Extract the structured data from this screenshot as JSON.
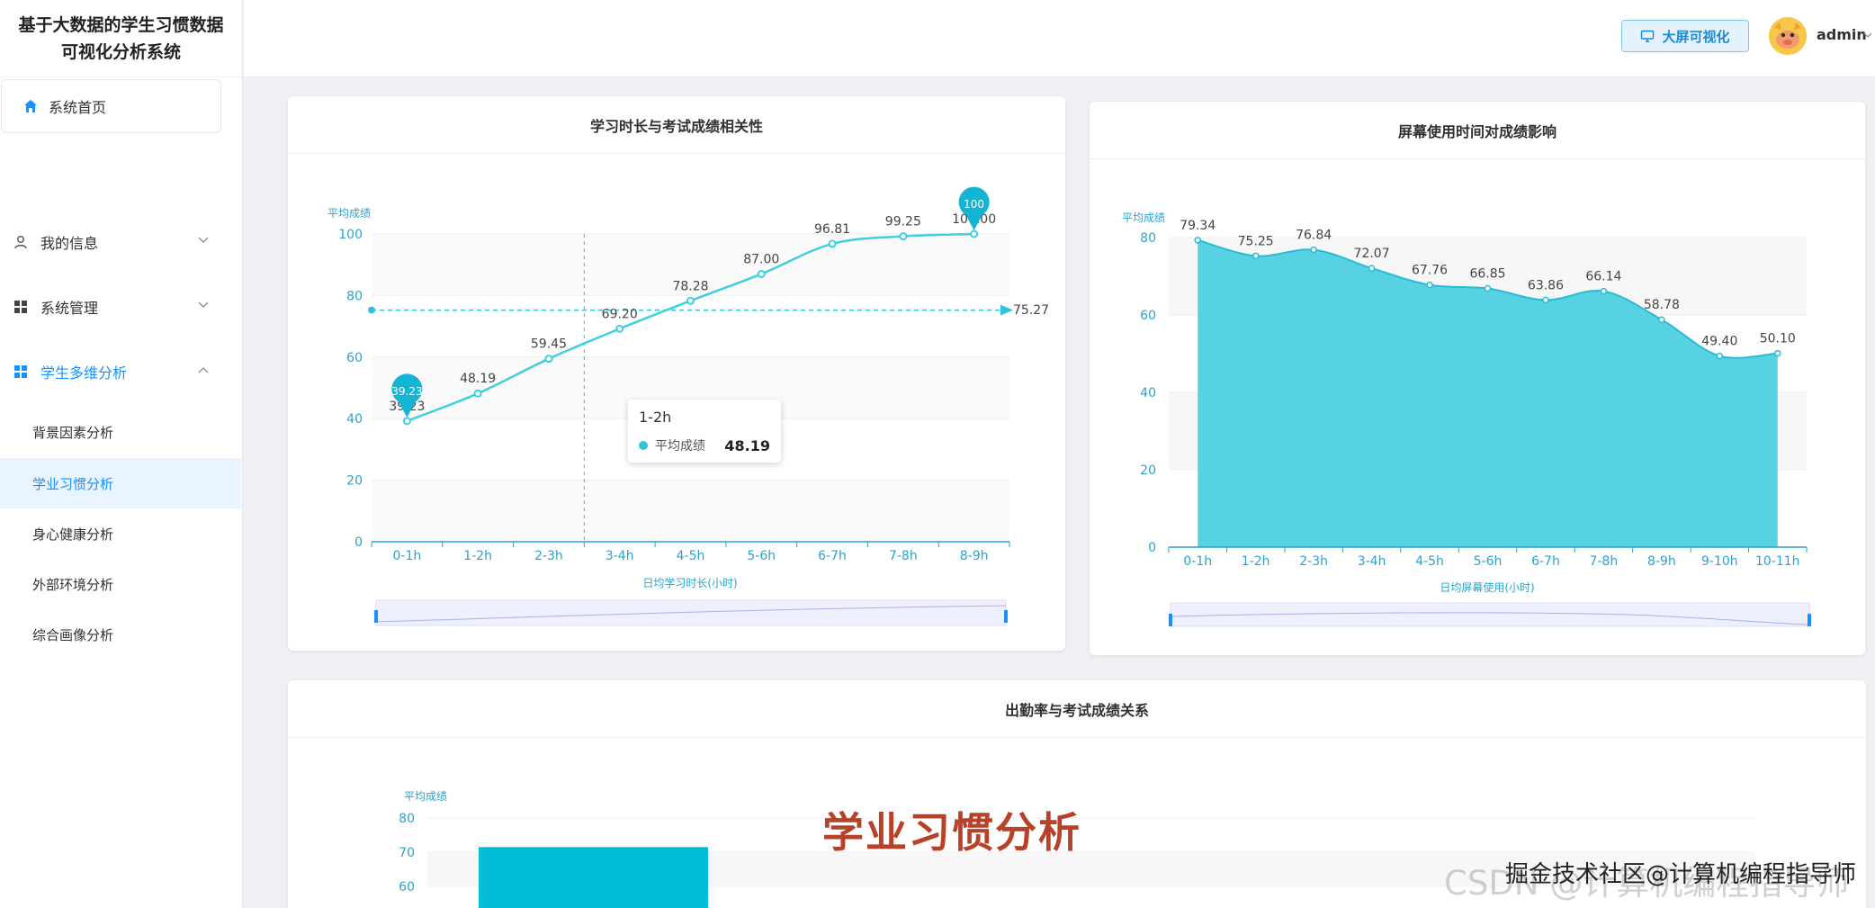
{
  "app": {
    "title_line1": "基于大数据的学生习惯数据",
    "title_line2": "可视化分析系统"
  },
  "header": {
    "big_screen_button": "大屏可视化",
    "username": "admin"
  },
  "sidebar": {
    "home": "系统首页",
    "items": [
      {
        "label": "我的信息"
      },
      {
        "label": "系统管理"
      },
      {
        "label": "学生多维分析"
      }
    ],
    "subitems": [
      {
        "label": "背景因素分析"
      },
      {
        "label": "学业习惯分析"
      },
      {
        "label": "身心健康分析"
      },
      {
        "label": "外部环境分析"
      },
      {
        "label": "综合画像分析"
      }
    ]
  },
  "chart_data": [
    {
      "type": "line",
      "title": "学习时长与考试成绩相关性",
      "xlabel": "日均学习时长(小时)",
      "ylabel": "平均成绩",
      "categories": [
        "0-1h",
        "1-2h",
        "2-3h",
        "3-4h",
        "4-5h",
        "5-6h",
        "6-7h",
        "7-8h",
        "8-9h"
      ],
      "values": [
        39.23,
        48.19,
        59.45,
        69.2,
        78.28,
        87.0,
        96.81,
        99.25,
        100.0
      ],
      "ylim": [
        0,
        100
      ],
      "yticks": [
        0,
        20,
        40,
        60,
        80,
        100
      ],
      "average_line": 75.27,
      "markpoint_min": "39.23",
      "markpoint_max": "100",
      "tooltip": {
        "category": "1-2h",
        "series": "平均成绩",
        "value": "48.19"
      }
    },
    {
      "type": "area",
      "title": "屏幕使用时间对成绩影响",
      "xlabel": "日均屏幕使用(小时)",
      "ylabel": "平均成绩",
      "categories": [
        "0-1h",
        "1-2h",
        "2-3h",
        "3-4h",
        "4-5h",
        "5-6h",
        "6-7h",
        "7-8h",
        "8-9h",
        "9-10h",
        "10-11h"
      ],
      "values": [
        79.34,
        75.25,
        76.84,
        72.07,
        67.76,
        66.85,
        63.86,
        66.14,
        58.78,
        49.4,
        50.1
      ],
      "ylim": [
        0,
        80
      ],
      "yticks": [
        0,
        20,
        40,
        60,
        80
      ]
    },
    {
      "type": "bar",
      "title": "出勤率与考试成绩关系",
      "ylabel": "平均成绩",
      "yticks": [
        60,
        70,
        80
      ],
      "ylim_visible": [
        56,
        80
      ],
      "values": [
        71.5
      ]
    }
  ],
  "overlay": {
    "title": "学业习惯分析",
    "watermark": "CSDN @计算机编程指导师",
    "watermark2": "掘金技术社区@计算机编程指导师"
  },
  "colors": {
    "primary": "#1890ff",
    "series": "#2fc4dc",
    "area": "#4dd0e1",
    "axis": "#2aa3cf",
    "overlay": "#b8412a"
  }
}
